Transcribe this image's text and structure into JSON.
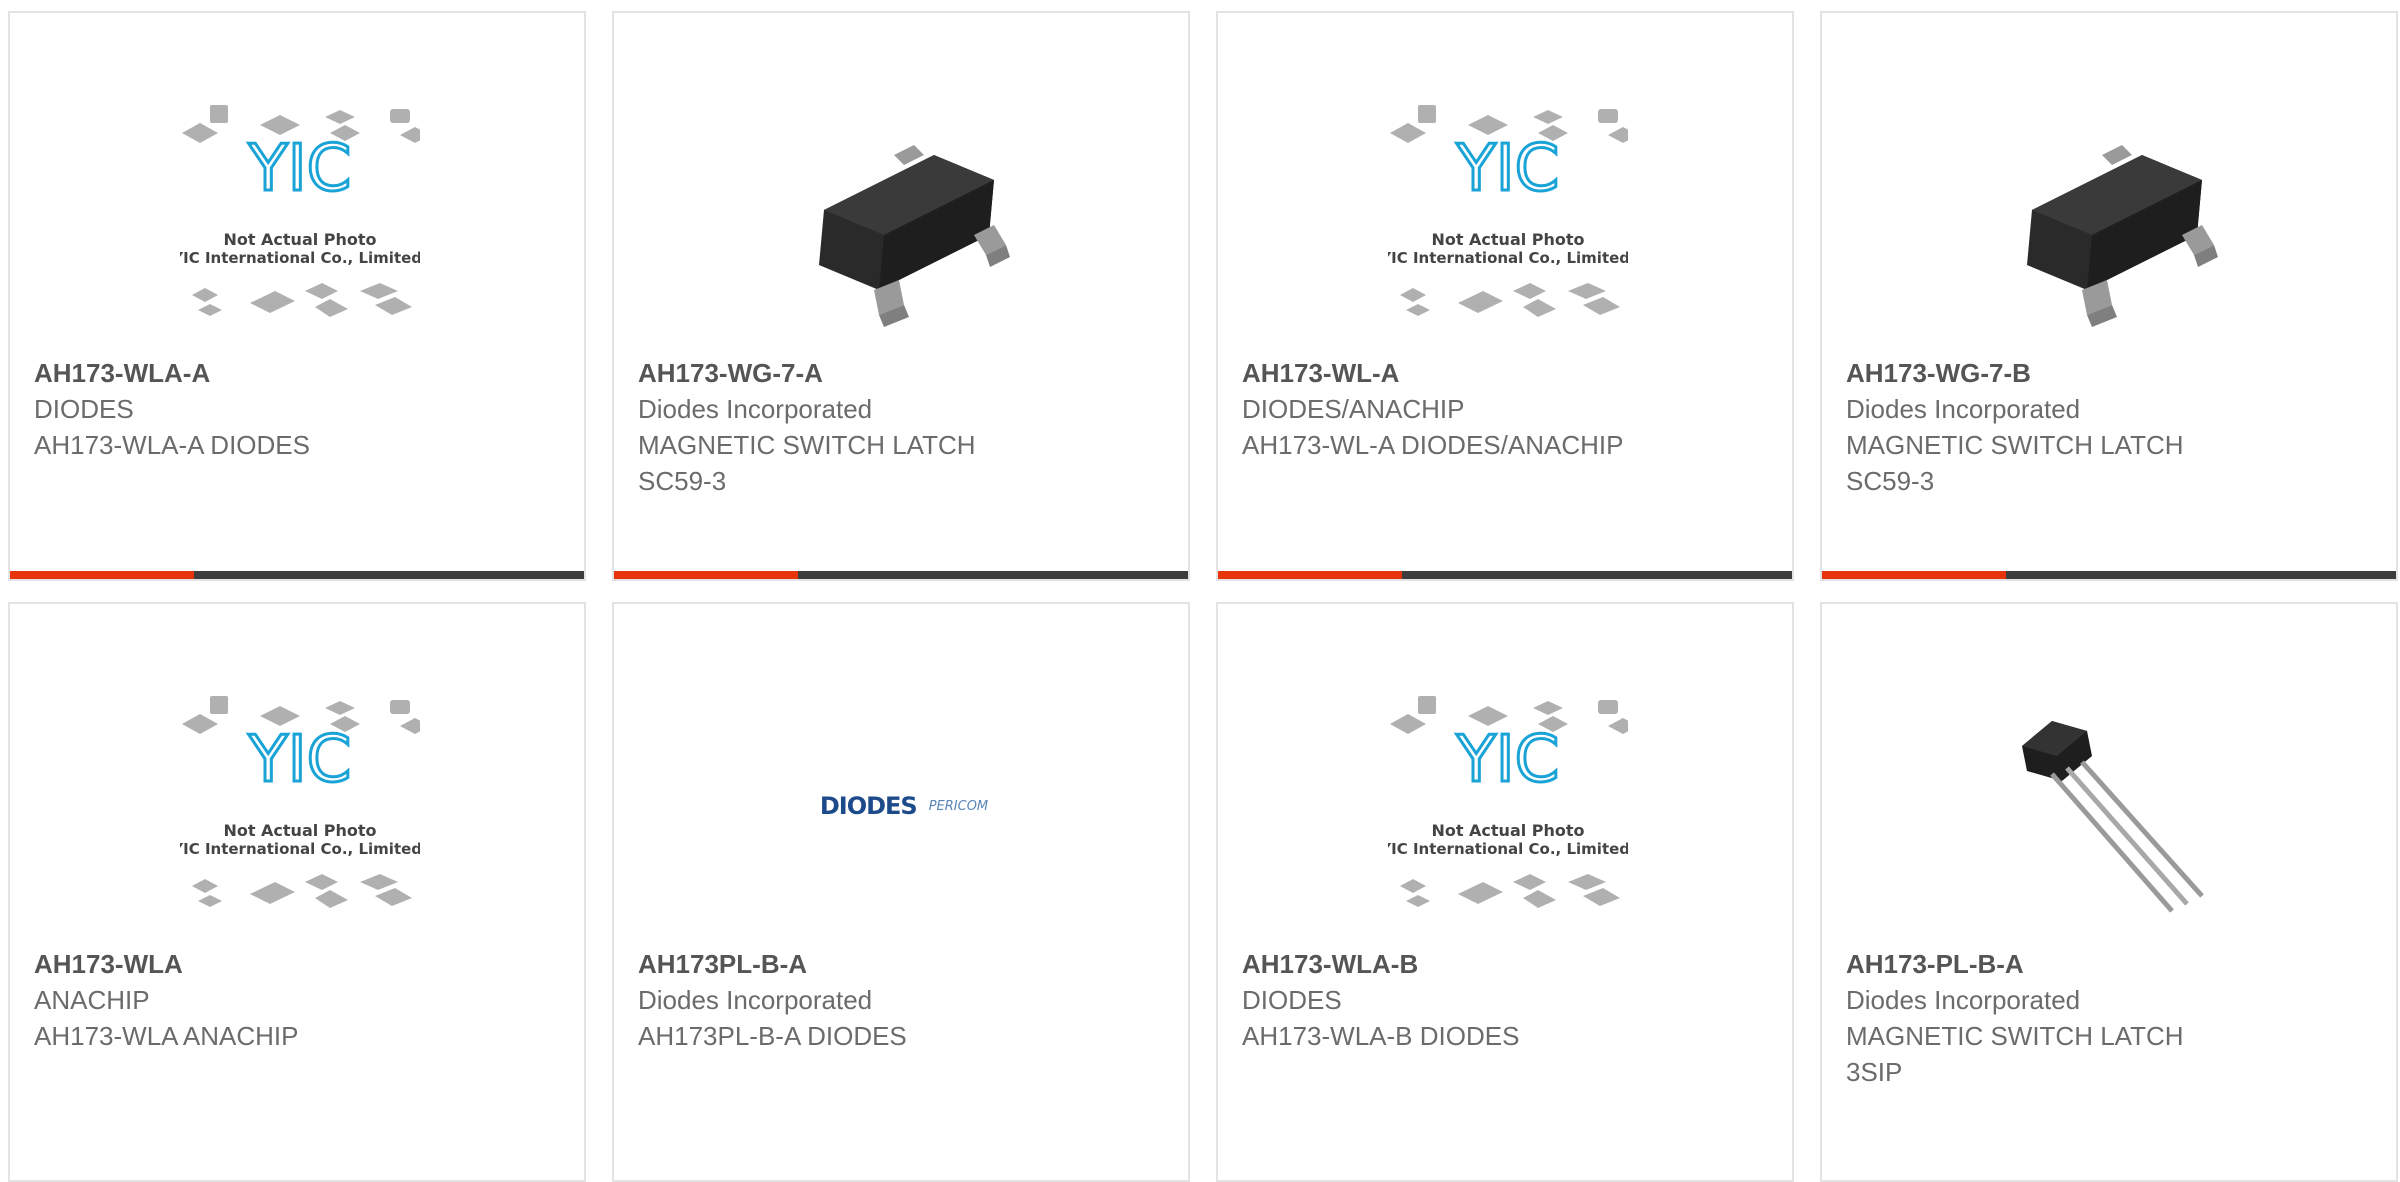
{
  "colors": {
    "accent": "#e8340c",
    "track": "#3d3d3d",
    "border": "#e3e3e3",
    "part_number": "#555555",
    "text": "#6b6b6b",
    "yic_logo": "#1aa3d6",
    "chip_gray": "#a8a8a8",
    "diodes_brand": "#1c4a8a"
  },
  "placeholder_image": {
    "logo_text": "YIC",
    "caption_line1": "Not Actual Photo",
    "caption_line2": "YIC International Co., Limited."
  },
  "products": [
    {
      "part_number": "AH173-WLA-A",
      "manufacturer": "DIODES",
      "description_lines": [
        "AH173-WLA-A DIODES"
      ],
      "image": "yic-placeholder-icon",
      "progress": 0.32
    },
    {
      "part_number": "AH173-WG-7-A",
      "manufacturer": "Diodes Incorporated",
      "description_lines": [
        "MAGNETIC SWITCH LATCH",
        "SC59-3"
      ],
      "image": "sot23-chip-icon",
      "progress": 0.32
    },
    {
      "part_number": "AH173-WL-A",
      "manufacturer": "DIODES/ANACHIP",
      "description_lines": [
        "AH173-WL-A DIODES/ANACHIP"
      ],
      "image": "yic-placeholder-icon",
      "progress": 0.32
    },
    {
      "part_number": "AH173-WG-7-B",
      "manufacturer": "Diodes Incorporated",
      "description_lines": [
        "MAGNETIC SWITCH LATCH",
        "SC59-3"
      ],
      "image": "sot23-chip-icon",
      "progress": 0.32
    },
    {
      "part_number": "AH173-WLA",
      "manufacturer": "ANACHIP",
      "description_lines": [
        "AH173-WLA ANACHIP"
      ],
      "image": "yic-placeholder-icon"
    },
    {
      "part_number": "AH173PL-B-A",
      "manufacturer": "Diodes Incorporated",
      "description_lines": [
        "AH173PL-B-A DIODES"
      ],
      "image": "diodes-pericom-logo",
      "brand_primary": "DIODES",
      "brand_secondary": "PERICOM"
    },
    {
      "part_number": "AH173-WLA-B",
      "manufacturer": "DIODES",
      "description_lines": [
        "AH173-WLA-B DIODES"
      ],
      "image": "yic-placeholder-icon"
    },
    {
      "part_number": "AH173-PL-B-A",
      "manufacturer": "Diodes Incorporated",
      "description_lines": [
        "MAGNETIC SWITCH LATCH",
        "3SIP"
      ],
      "image": "to92-sip-icon"
    }
  ]
}
